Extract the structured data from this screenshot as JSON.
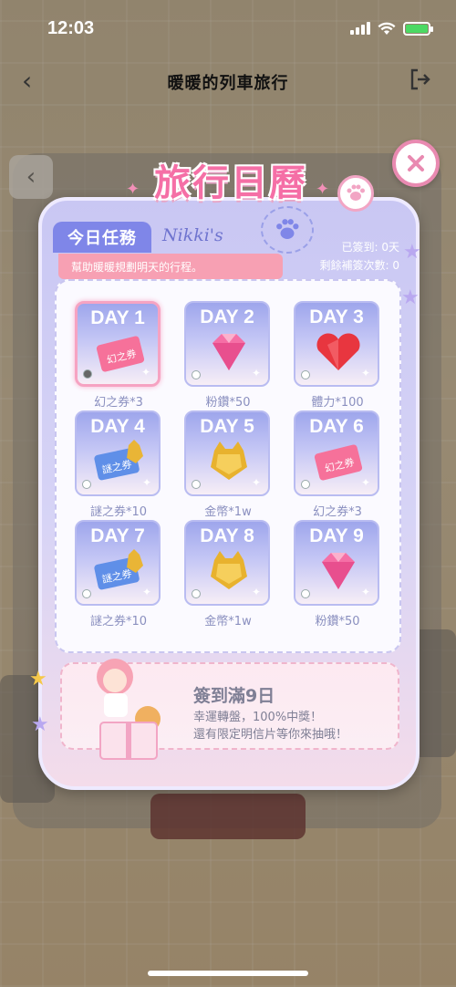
{
  "status_bar": {
    "time": "12:03"
  },
  "nav": {
    "title": "暖暖的列車旅行"
  },
  "modal": {
    "title": "旅行日曆",
    "task_tag": "今日任務",
    "brand": "Nikki's",
    "signed_days": "已簽到: 0天",
    "makeup_count": "剩餘補簽次數: 0",
    "task_desc": "幫助暖暖規劃明天的行程。"
  },
  "days": [
    {
      "label": "DAY 1",
      "reward": "幻之券*3",
      "art": "ticket-pink"
    },
    {
      "label": "DAY 2",
      "reward": "粉鑽*50",
      "art": "diamond"
    },
    {
      "label": "DAY 3",
      "reward": "體力*100",
      "art": "heart"
    },
    {
      "label": "DAY 4",
      "reward": "謎之券*10",
      "art": "ticket-blue"
    },
    {
      "label": "DAY 5",
      "reward": "金幣*1w",
      "art": "coin"
    },
    {
      "label": "DAY 6",
      "reward": "幻之券*3",
      "art": "ticket-pink"
    },
    {
      "label": "DAY 7",
      "reward": "謎之券*10",
      "art": "ticket-blue"
    },
    {
      "label": "DAY 8",
      "reward": "金幣*1w",
      "art": "coin"
    },
    {
      "label": "DAY 9",
      "reward": "粉鑽*50",
      "art": "diamond"
    }
  ],
  "ticket_labels": {
    "pink": "幻之券",
    "blue": "謎之券"
  },
  "bonus": {
    "title": "簽到滿9日",
    "line1": "幸運轉盤，100%中獎！",
    "line2": "還有限定明信片等你來抽哦！"
  },
  "colors": {
    "accent_pink": "#f56fa6",
    "accent_purple": "#7f86e8"
  }
}
